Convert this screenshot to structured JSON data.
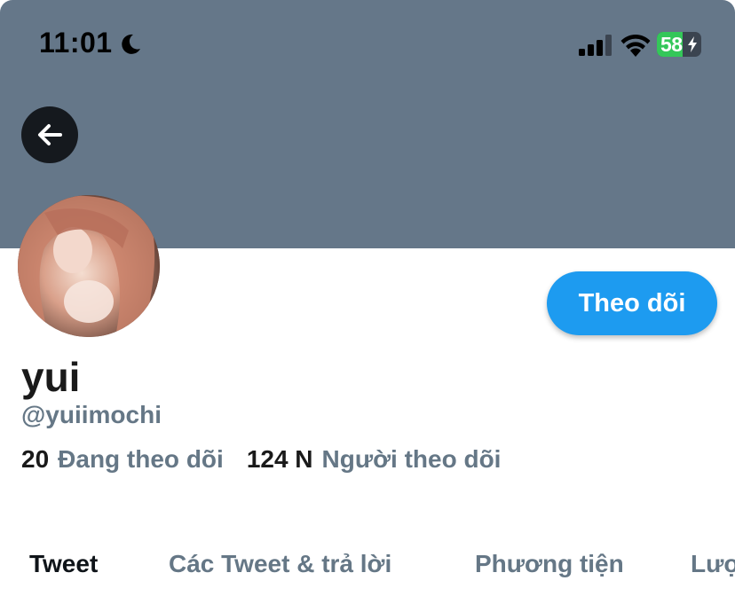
{
  "status_bar": {
    "time": "11:01",
    "battery_percent": "58",
    "battery_level": 0.58,
    "focus_icon": "moon-icon",
    "signal_icon": "cellular-signal-icon",
    "wifi_icon": "wifi-icon",
    "charging_icon": "bolt-icon"
  },
  "header": {
    "banner_color": "#657789",
    "back_icon": "arrow-left-icon"
  },
  "profile": {
    "display_name": "yui",
    "handle": "@yuiimochi",
    "follow_button_label": "Theo dõi",
    "following_count": "20",
    "following_label": "Đang theo dõi",
    "followers_count": "124 N",
    "followers_label": "Người theo dõi"
  },
  "tabs": [
    {
      "label": "Tweet",
      "active": true
    },
    {
      "label": "Các Tweet & trả lời",
      "active": false
    },
    {
      "label": "Phương tiện",
      "active": false
    },
    {
      "label": "Lượt thích",
      "active": false
    }
  ],
  "colors": {
    "accent": "#1d9bf0",
    "secondary_text": "#657786",
    "battery_green": "#34c759"
  }
}
